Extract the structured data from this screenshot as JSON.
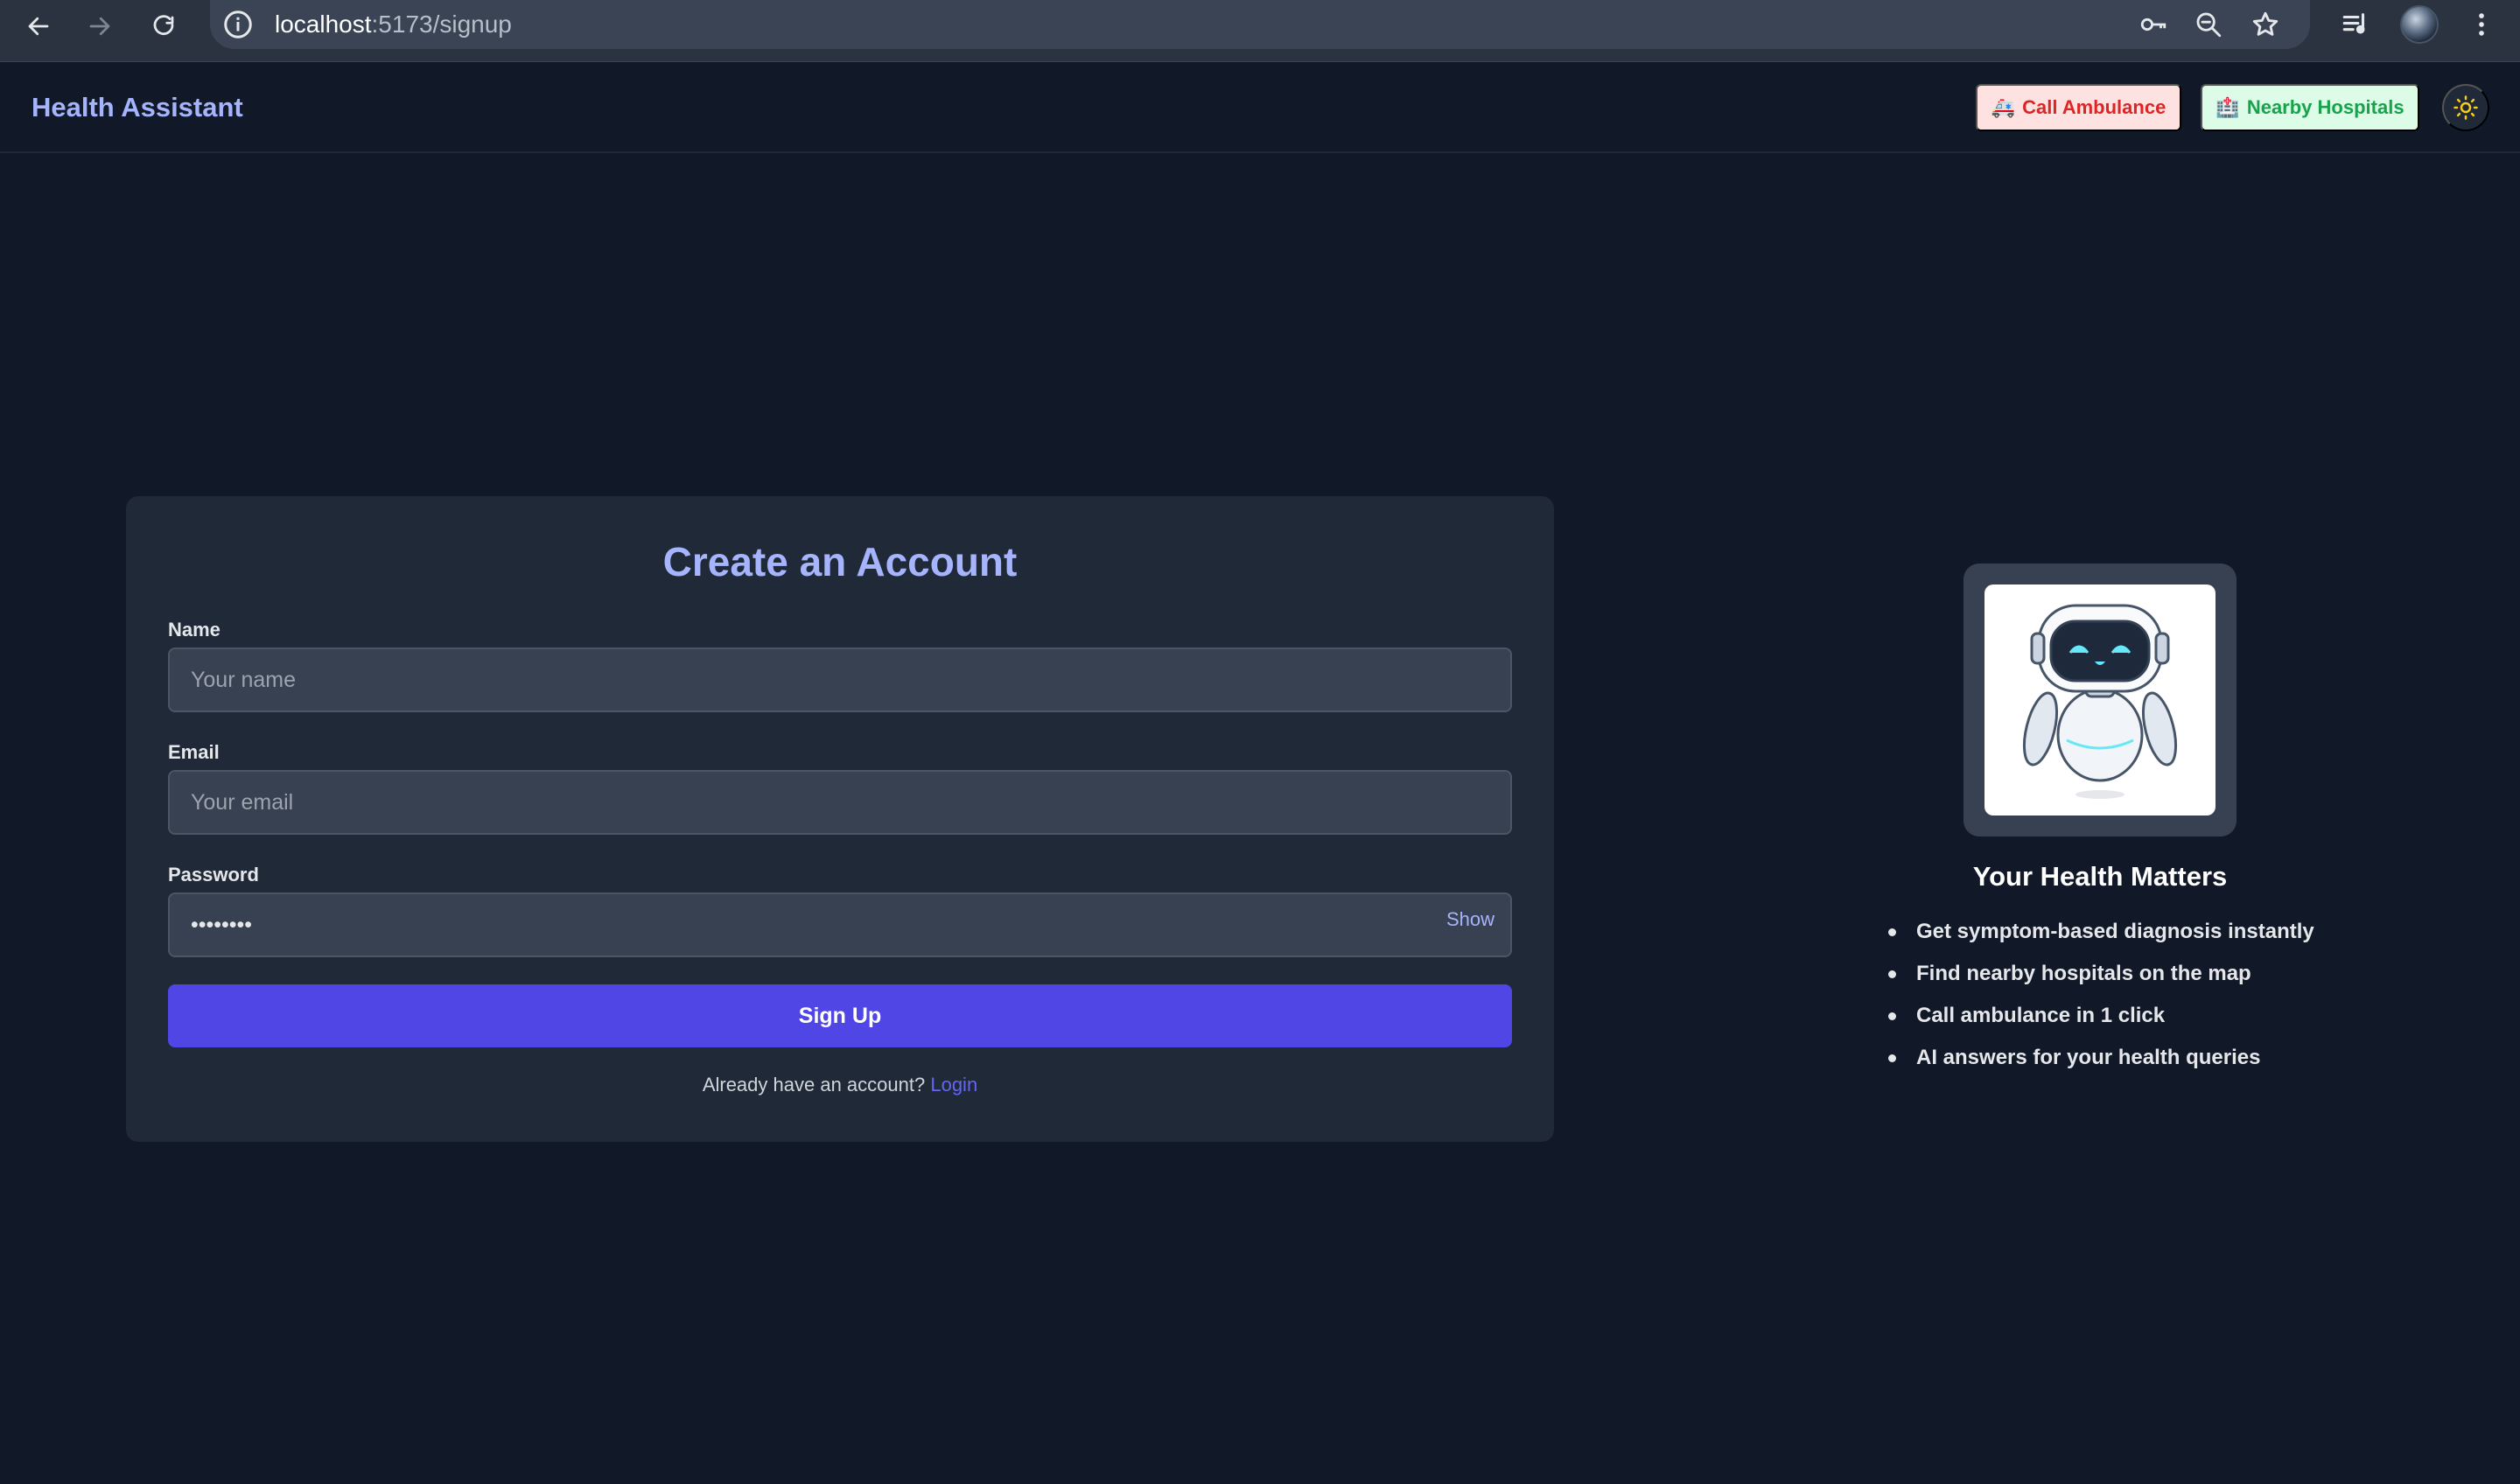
{
  "browser": {
    "url_host": "localhost",
    "url_path": ":5173/signup"
  },
  "header": {
    "brand": "Health Assistant",
    "ambulance_icon": "🚑",
    "ambulance_label": "Call Ambulance",
    "hospital_icon": "🏥",
    "hospital_label": "Nearby Hospitals",
    "theme_icon": "sun-icon"
  },
  "signup": {
    "title": "Create an Account",
    "name_label": "Name",
    "name_placeholder": "Your name",
    "email_label": "Email",
    "email_placeholder": "Your email",
    "password_label": "Password",
    "password_value": "••••••••",
    "show_label": "Show",
    "submit_label": "Sign Up",
    "footer_text": "Already have an account?",
    "login_link": "Login"
  },
  "info": {
    "image": "robot-illustration",
    "title": "Your Health Matters",
    "features": [
      "Get symptom-based diagnosis instantly",
      "Find nearby hospitals on the map",
      "Call ambulance in 1 click",
      "AI answers for your health queries"
    ]
  },
  "colors": {
    "background": "#111827",
    "card": "#1f2937",
    "accent": "#4f46e5",
    "brand": "#a5b4fc",
    "ambulance_bg": "#fee2e2",
    "ambulance_text": "#dc2626",
    "hospital_bg": "#dcfce7",
    "hospital_text": "#16a34a"
  }
}
